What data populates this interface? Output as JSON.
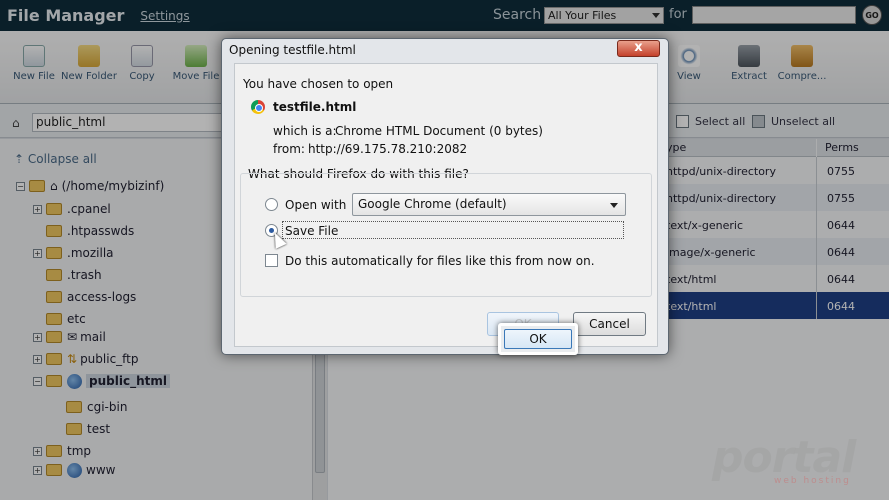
{
  "header": {
    "title": "File Manager",
    "settings_label": "Settings",
    "search_label": "Search",
    "search_scope": "All Your Files",
    "for_label": "for",
    "search_value": "",
    "go_label": "GO"
  },
  "toolbar": {
    "new_file": "New File",
    "new_folder": "New Folder",
    "copy": "Copy",
    "move_file": "Move File",
    "view": "View",
    "extract": "Extract",
    "compress": "Compre..."
  },
  "pathbar": {
    "path": "public_html",
    "select_all": "Select all",
    "unselect_all": "Unselect all"
  },
  "tree": {
    "collapse_all": "Collapse all",
    "root": "(/home/mybizinf)",
    "items": [
      {
        "label": ".cpanel"
      },
      {
        "label": ".htpasswds"
      },
      {
        "label": ".mozilla"
      },
      {
        "label": ".trash"
      },
      {
        "label": "access-logs"
      },
      {
        "label": "etc"
      },
      {
        "label": "mail"
      },
      {
        "label": "public_ftp"
      },
      {
        "label": "public_html"
      },
      {
        "label": "cgi-bin"
      },
      {
        "label": "test"
      },
      {
        "label": "tmp"
      },
      {
        "label": "www"
      }
    ]
  },
  "table": {
    "headers": {
      "type": "ype",
      "perms": "Perms"
    },
    "rows": [
      {
        "type": "httpd/unix-directory",
        "perms": "0755"
      },
      {
        "type": "httpd/unix-directory",
        "perms": "0755"
      },
      {
        "type": "text/x-generic",
        "perms": "0644"
      },
      {
        "type": "image/x-generic",
        "perms": "0644"
      },
      {
        "type": "text/html",
        "perms": "0644"
      },
      {
        "type": "text/html",
        "perms": "0644"
      }
    ]
  },
  "dialog": {
    "title": "Opening testfile.html",
    "close_label": "x",
    "intro": "You have chosen to open",
    "filename": "testfile.html",
    "which_is_label": "which is a:",
    "which_is_value": "Chrome HTML Document (0 bytes)",
    "from_label": "from:",
    "from_value": "http://69.175.78.210:2082",
    "question": "What should Firefox do with this file?",
    "open_with_label": "Open with",
    "open_with_app": "Google Chrome (default)",
    "save_file_label": "Save File",
    "auto_label": "Do this automatically for files like this from now on.",
    "ok_label": "OK",
    "cancel_label": "Cancel"
  },
  "watermark": {
    "brand": "portal",
    "tagline": "web hosting"
  }
}
